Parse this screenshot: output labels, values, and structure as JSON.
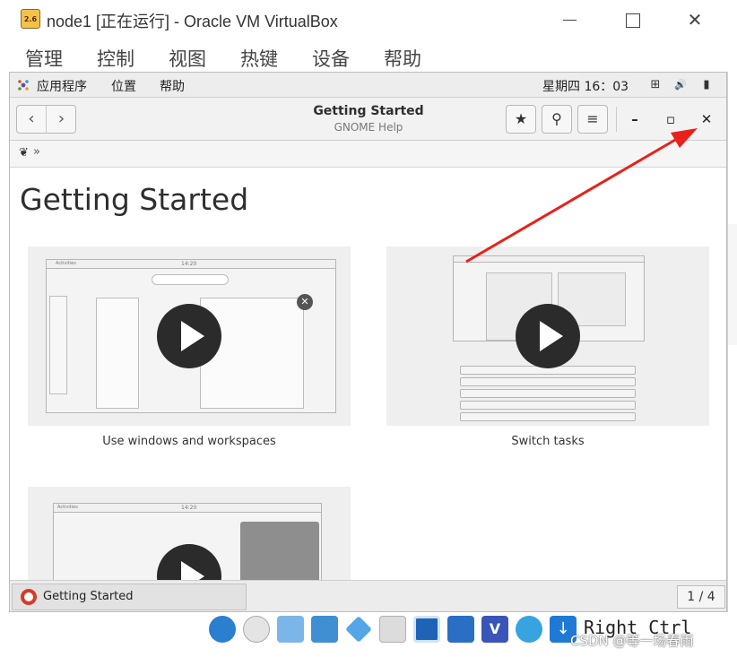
{
  "window": {
    "title": "node1 [正在运行] - Oracle VM VirtualBox",
    "icon_badge": "2.6",
    "minimize_icon": "minimize-icon",
    "maximize_icon": "maximize-icon",
    "close_icon": "close-icon",
    "close_glyph": "✕"
  },
  "menubar": {
    "items": [
      "管理",
      "控制",
      "视图",
      "热键",
      "设备",
      "帮助"
    ]
  },
  "gnome_topbar": {
    "apps_label": "应用程序",
    "places_label": "位置",
    "help_label": "帮助",
    "clock": "星期四 16：03",
    "tray_icons": [
      "network-icon",
      "volume-icon",
      "battery-icon"
    ],
    "tray_glyphs": [
      "⊞",
      "🔊",
      "▮"
    ]
  },
  "headerbar": {
    "title": "Getting Started",
    "subtitle": "GNOME Help",
    "back_glyph": "‹",
    "forward_glyph": "›",
    "bookmark_glyph": "★",
    "search_glyph": "⚲",
    "menu_glyph": "≡",
    "wm_minimize": "–",
    "wm_maximize": "▫",
    "wm_close": "✕"
  },
  "pathbar": {
    "home_glyph": "❦",
    "separator": "»"
  },
  "page": {
    "heading": "Getting Started",
    "cards": [
      {
        "label": "Use windows and workspaces",
        "video_icon": "play-icon"
      },
      {
        "label": "Switch tasks",
        "video_icon": "play-icon"
      },
      {
        "label": "",
        "video_icon": "play-icon"
      }
    ],
    "mock_topbar_label": "Activities",
    "mock_clock": "14:20"
  },
  "taskbar": {
    "task_label": "Getting Started",
    "pager": "1 / 4"
  },
  "statusbar": {
    "icons": [
      "hard-disk-icon",
      "optical-drive-icon",
      "audio-icon",
      "network-adapter-icon",
      "usb-icon",
      "shared-folder-icon",
      "display-icon",
      "capture-icon",
      "virtualization-icon",
      "guest-additions-icon",
      "mouse-integration-icon"
    ],
    "host_key": "Right Ctrl",
    "watermark": "CSDN @等一场春雨"
  },
  "annotation": {
    "arrow_color": "#e8211b"
  },
  "colors": {
    "play_button": "#2b2b2b",
    "card_bg": "#efefef",
    "topbar_bg": "#ededed"
  }
}
